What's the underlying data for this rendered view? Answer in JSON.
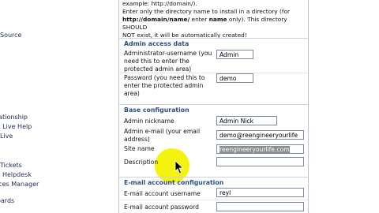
{
  "sidebar": {
    "items": [
      {
        "label": "Source"
      },
      {
        "label": "lationship"
      },
      {
        "label": "k Live Help"
      },
      {
        "label": "Live"
      },
      {
        "label": "Tickets"
      },
      {
        "label": "c Helpdesk"
      },
      {
        "label": "ices Manager"
      },
      {
        "label": "oards"
      }
    ]
  },
  "intro": {
    "line1": "example: http://domain/).",
    "line2": "Enter only the directory name to install in a directory (for",
    "line3a": "http://domain/name/",
    "line3b": " enter ",
    "line3c": "name",
    "line3d": " only). This directory SHOULD",
    "line4": "NOT exist, it will be automatically created!"
  },
  "admin_access": {
    "heading": "Admin access data",
    "username_label": "Administrator-username (you need this to enter the protected admin area)",
    "username_value": "Admin",
    "password_label": "Password (you need this to enter the protected admin area)",
    "password_value": "demo"
  },
  "base_config": {
    "heading": "Base configuration",
    "nickname_label": "Admin nickname",
    "nickname_value": "Admin Nick",
    "email_label": "Admin e-mail (your email address)",
    "email_value": "demo@reengineeryourlife",
    "sitename_label": "Site name",
    "sitename_value": "reengineeryourlife.com",
    "description_label": "Description",
    "description_value": ""
  },
  "email_config": {
    "heading": "E-mail account configuration",
    "username_label": "E-mail account username",
    "username_value": "reyl",
    "password_label": "E-mail account password",
    "password_value": ""
  },
  "colors": {
    "section_heading": "#2b4f83",
    "highlight": "#f3f200"
  }
}
